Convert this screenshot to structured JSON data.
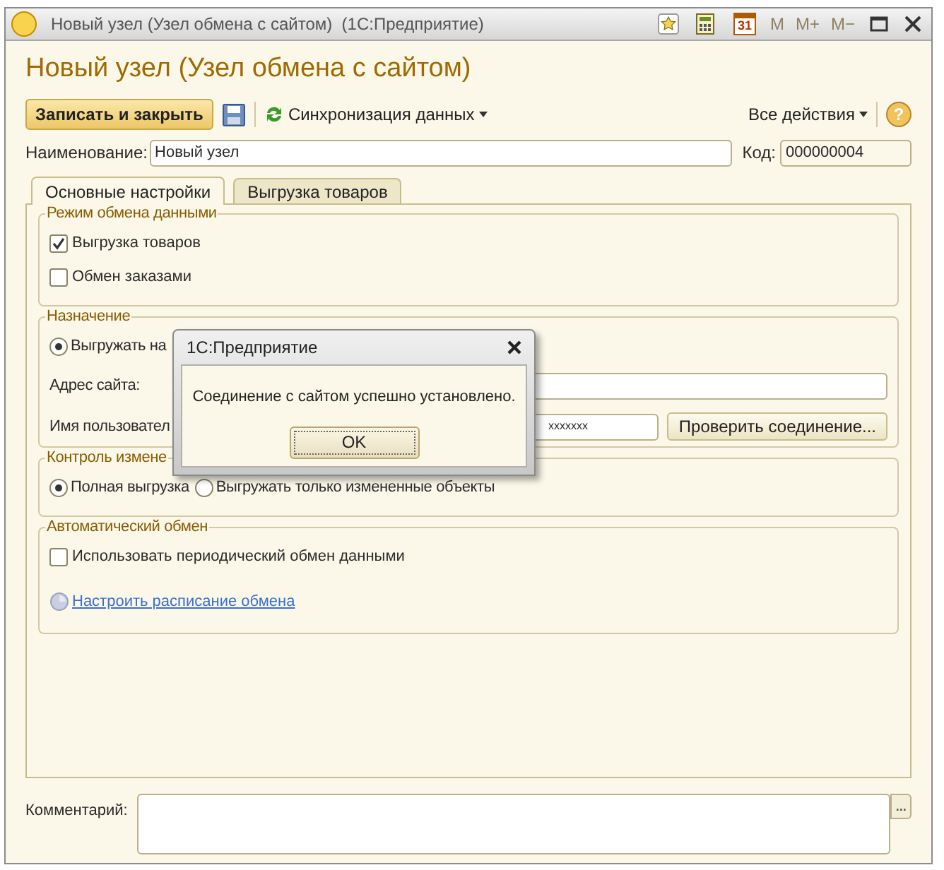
{
  "window": {
    "title": "Новый узел (Узел обмена с сайтом)  (1С:Предприятие)",
    "tools": [
      {
        "kind": "star"
      },
      {
        "kind": "calculator"
      },
      {
        "kind": "calendar",
        "label": "31"
      }
    ],
    "memory_buttons": [
      {
        "label": "M",
        "disabled": true
      },
      {
        "label": "M+",
        "disabled": true
      },
      {
        "label": "M−",
        "disabled": true
      }
    ]
  },
  "form": {
    "heading": "Новый узел (Узел обмена с сайтом)",
    "toolbar": {
      "primary_button": "Записать и закрыть",
      "sync_menu": "Синхронизация данных",
      "all_actions": "Все действия",
      "help": "?"
    },
    "name": {
      "label": "Наименование:",
      "value": "Новый узел"
    },
    "code": {
      "label": "Код:",
      "value": "000000004"
    },
    "tabs": [
      {
        "label": "Основные настройки",
        "selected": true
      },
      {
        "label": "Выгрузка товаров",
        "selected": false
      }
    ],
    "groups": [
      {
        "legend": "Режим обмена данными",
        "items": [
          {
            "kind": "checkbox",
            "label": "Выгрузка товаров",
            "checked": true
          },
          {
            "kind": "checkbox",
            "label": "Обмен заказами",
            "checked": false
          }
        ]
      },
      {
        "legend": "Назначение",
        "items": [
          {
            "kind": "radios",
            "options": [
              {
                "label": "Выгружать на",
                "selected": true
              }
            ]
          },
          {
            "kind": "field",
            "label": "Адрес сайта:"
          },
          {
            "kind": "field",
            "label": "Имя пользовател",
            "value": "xxxxxxx",
            "button": "Проверить соединение..."
          }
        ]
      },
      {
        "legend": "Контроль измене",
        "items": [
          {
            "kind": "radios",
            "options": [
              {
                "label": "Полная выгрузка",
                "selected": true
              },
              {
                "label": "Выгружать только измененные объекты",
                "selected": false
              }
            ]
          }
        ]
      },
      {
        "legend": "Автоматический обмен",
        "items": [
          {
            "kind": "checkbox",
            "label": "Использовать периодический обмен данными",
            "checked": false
          },
          {
            "kind": "link",
            "label": "Настроить расписание обмена"
          }
        ]
      }
    ],
    "comment": {
      "label": "Комментарий:",
      "button": "..."
    }
  },
  "dialog": {
    "title": "1С:Предприятие",
    "message": "Соединение с сайтом успешно установлено.",
    "button": "OK"
  }
}
